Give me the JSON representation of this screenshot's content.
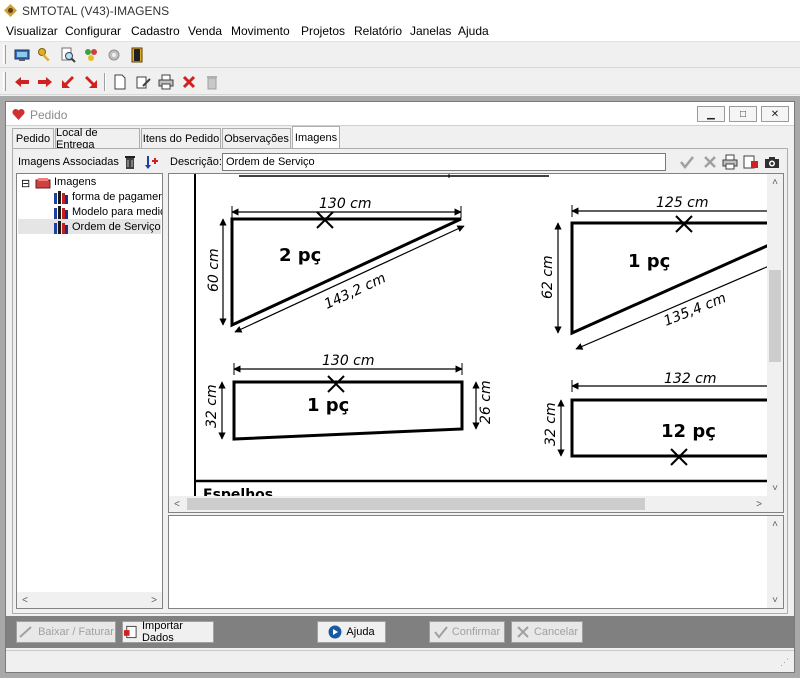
{
  "app": {
    "title": "SMTOTAL (V43)-IMAGENS"
  },
  "menu": [
    "Visualizar",
    "Configurar",
    "Cadastro",
    "Venda",
    "Movimento",
    "Projetos",
    "Relatório",
    "Janelas",
    "Ajuda"
  ],
  "toolbar1": [
    "monitor-icon",
    "key-icon",
    "search-doc-icon",
    "tools-icon",
    "puzzle-icon",
    "exit-door-icon"
  ],
  "toolbar2": [
    "arrow-left-icon",
    "arrow-right-icon",
    "arrow-down-left-icon",
    "arrow-down-right-icon",
    "new-doc-icon",
    "edit-doc-icon",
    "print-icon",
    "delete-x-icon",
    "trash-icon"
  ],
  "window": {
    "title": "Pedido"
  },
  "tabs": [
    "Pedido",
    "Local de Entrega",
    "Itens do Pedido",
    "Observações",
    "Imagens"
  ],
  "active_tab": "Imagens",
  "left_panel": {
    "label": "Imagens Associadas",
    "tree_root": "Imagens",
    "items": [
      "forma de pagamento",
      "Modelo para mediçã",
      "Ordem de Serviço"
    ],
    "selected": "Ordem de Serviço"
  },
  "description": {
    "label": "Descrição:",
    "value": "Ordem de Serviço"
  },
  "drawing": {
    "shape1": {
      "top": "130 cm",
      "left": "60 cm",
      "diag": "143,2 cm",
      "qty": "2 pç"
    },
    "shape2": {
      "top": "125 cm",
      "left": "62 cm",
      "diag": "135,4 cm",
      "qty": "1 pç"
    },
    "shape3": {
      "top": "130 cm",
      "left": "32 cm",
      "right": "26 cm",
      "qty": "1 pç"
    },
    "shape4": {
      "top": "132 cm",
      "left": "32 cm",
      "qty": "12 pç"
    },
    "footer_text": "Espelhos"
  },
  "buttons": {
    "baixar": "Baixar / Faturar",
    "importar": "Importar Dados",
    "ajuda": "Ajuda",
    "confirmar": "Confirmar",
    "cancelar": "Cancelar"
  }
}
